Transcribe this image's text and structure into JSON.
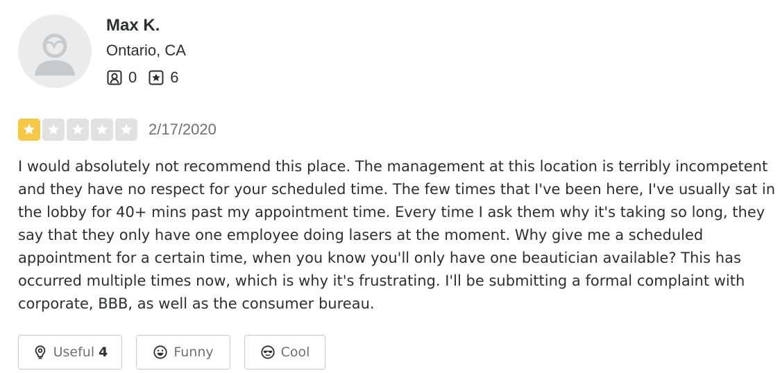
{
  "reviewer": {
    "name": "Max K.",
    "location": "Ontario, CA",
    "friends_count": "0",
    "reviews_count": "6",
    "avatar_icon": "default-user-silhouette-icon",
    "friends_icon": "friends-icon",
    "reviews_icon": "star-review-icon"
  },
  "rating": {
    "value": 1,
    "max": 5,
    "filled_color": "#f7c844",
    "empty_color": "#e1e1e1",
    "date": "2/17/2020"
  },
  "review": {
    "text": "I would absolutely not recommend this place. The management at this location is terribly incompetent and they have no respect for your scheduled time. The few times that I've been here, I've usually sat in the lobby for 40+ mins past my appointment time. Every time I ask them why it's taking so long, they say that they only have one employee doing lasers at the moment. Why give me a scheduled appointment for a certain time, when you know you'll only have one beautician available? This has occurred multiple times now, which is why it's frustrating. I'll be submitting a formal complaint with corporate, BBB, as well as the consumer bureau."
  },
  "reactions": {
    "useful_label": "Useful",
    "useful_count": "4",
    "funny_label": "Funny",
    "cool_label": "Cool",
    "useful_icon": "lightbulb-icon",
    "funny_icon": "smile-icon",
    "cool_icon": "sunglasses-icon"
  }
}
